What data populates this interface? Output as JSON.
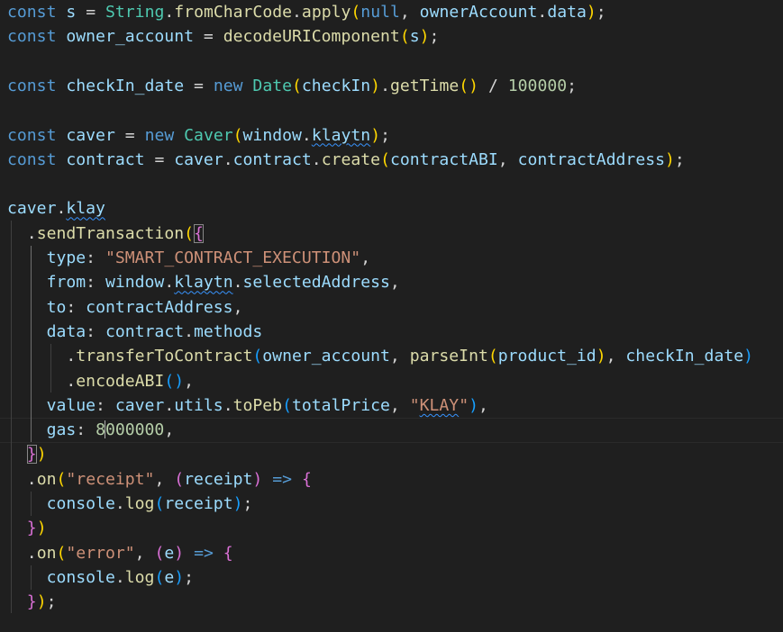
{
  "editor": {
    "theme": "dark",
    "colors": {
      "background": "#1f1f1f",
      "keyword": "#569cd6",
      "variable": "#9cdcfe",
      "function": "#dcdcaa",
      "class": "#4ec9b0",
      "string": "#ce9178",
      "number": "#b5cea8",
      "bracket_level_1": "#ffd700",
      "bracket_level_2": "#da70d6",
      "bracket_level_3": "#179fff"
    },
    "code_lines": [
      "const s = String.fromCharCode.apply(null, ownerAccount.data);",
      "const owner_account = decodeURIComponent(s);",
      "",
      "const checkIn_date = new Date(checkIn).getTime() / 100000;",
      "",
      "const caver = new Caver(window.klaytn);",
      "const contract = caver.contract.create(contractABI, contractAddress);",
      "",
      "caver.klay",
      "  .sendTransaction({",
      "    type: \"SMART_CONTRACT_EXECUTION\",",
      "    from: window.klaytn.selectedAddress,",
      "    to: contractAddress,",
      "    data: contract.methods",
      "      .transferToContract(owner_account, parseInt(product_id), checkIn_date)",
      "      .encodeABI(),",
      "    value: caver.utils.toPeb(totalPrice, \"KLAY\"),",
      "    gas: 8000000,",
      "  })",
      "  .on(\"receipt\", (receipt) => {",
      "    console.log(receipt);",
      "  })",
      "  .on(\"error\", (e) => {",
      "    console.log(e);",
      "  });"
    ],
    "tok": {
      "const": "const",
      "new": "new",
      "null": "null",
      "arrow": "=>",
      "s": "s",
      "String": "String",
      "fromCharCode": "fromCharCode",
      "apply": "apply",
      "ownerAccount": "ownerAccount",
      "data": "data",
      "owner_account": "owner_account",
      "decodeURIComponent": "decodeURIComponent",
      "checkIn_date": "checkIn_date",
      "Date": "Date",
      "checkIn": "checkIn",
      "getTime": "getTime",
      "num_100000": "100000",
      "caver": "caver",
      "Caver": "Caver",
      "window": "window",
      "klaytn": "klaytn",
      "contract": "contract",
      "create": "create",
      "contractABI": "contractABI",
      "contractAddress": "contractAddress",
      "klay": "klay",
      "sendTransaction": "sendTransaction",
      "type": "type",
      "str_sce": "\"SMART_CONTRACT_EXECUTION\"",
      "from": "from",
      "selectedAddress": "selectedAddress",
      "to": "to",
      "methods": "methods",
      "transferToContract": "transferToContract",
      "parseInt": "parseInt",
      "product_id": "product_id",
      "encodeABI": "encodeABI",
      "value": "value",
      "utils": "utils",
      "toPeb": "toPeb",
      "totalPrice": "totalPrice",
      "str_klay_q1": "\"",
      "str_klay_word": "KLAY",
      "str_klay_q2": "\"",
      "gas": "gas",
      "gas_digit_1": "8",
      "gas_rest": "000000",
      "on": "on",
      "str_receipt": "\"receipt\"",
      "receipt": "receipt",
      "str_error": "\"error\"",
      "e": "e",
      "console": "console",
      "log": "log"
    }
  }
}
